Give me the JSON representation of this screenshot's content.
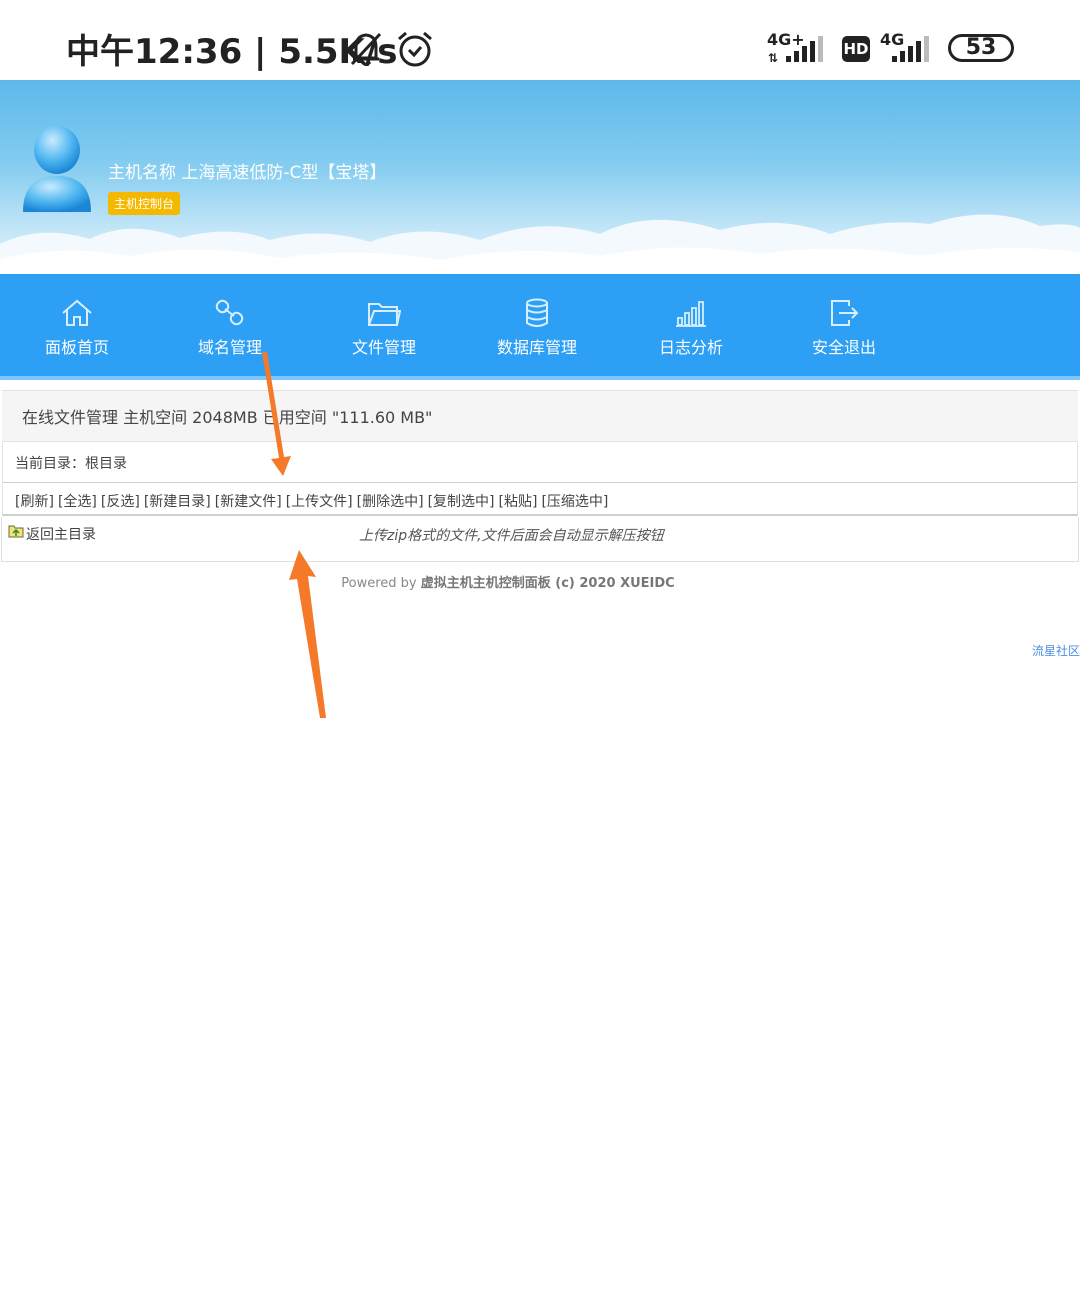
{
  "status": {
    "time": "中午12:36 | 5.5K/s",
    "net1": "4G+",
    "hd": "HD",
    "net2": "4G",
    "battery": "53"
  },
  "header": {
    "host_name": "主机名称 上海高速低防-C型【宝塔】",
    "console_badge": "主机控制台"
  },
  "nav": {
    "items": [
      {
        "label": "面板首页",
        "icon": "home-icon"
      },
      {
        "label": "域名管理",
        "icon": "link-icon"
      },
      {
        "label": "文件管理",
        "icon": "folder-icon"
      },
      {
        "label": "数据库管理",
        "icon": "database-icon"
      },
      {
        "label": "日志分析",
        "icon": "bar-chart-icon"
      },
      {
        "label": "安全退出",
        "icon": "logout-icon"
      }
    ]
  },
  "content": {
    "title": "在线文件管理 主机空间 2048MB 已用空间 \"111.60 MB\"",
    "current_dir": "当前目录：根目录",
    "toolbar": [
      "[刷新]",
      "[全选]",
      "[反选]",
      "[新建目录]",
      "[新建文件]",
      "[上传文件]",
      "[删除选中]",
      "[复制选中]",
      "[粘贴]",
      "[压缩选中]"
    ],
    "back_link": "返回主目录",
    "hint": "上传zip格式的文件,文件后面会自动显示解压按钮"
  },
  "footer": {
    "prefix": "Powered by ",
    "brand": "虚拟主机主机控制面板",
    "suffix": " (c) 2020 XUEIDC"
  },
  "community_link": "流星社区",
  "colors": {
    "nav_bg": "#2d9ff5",
    "badge": "#f5b800",
    "arrow": "#f47a2a"
  }
}
